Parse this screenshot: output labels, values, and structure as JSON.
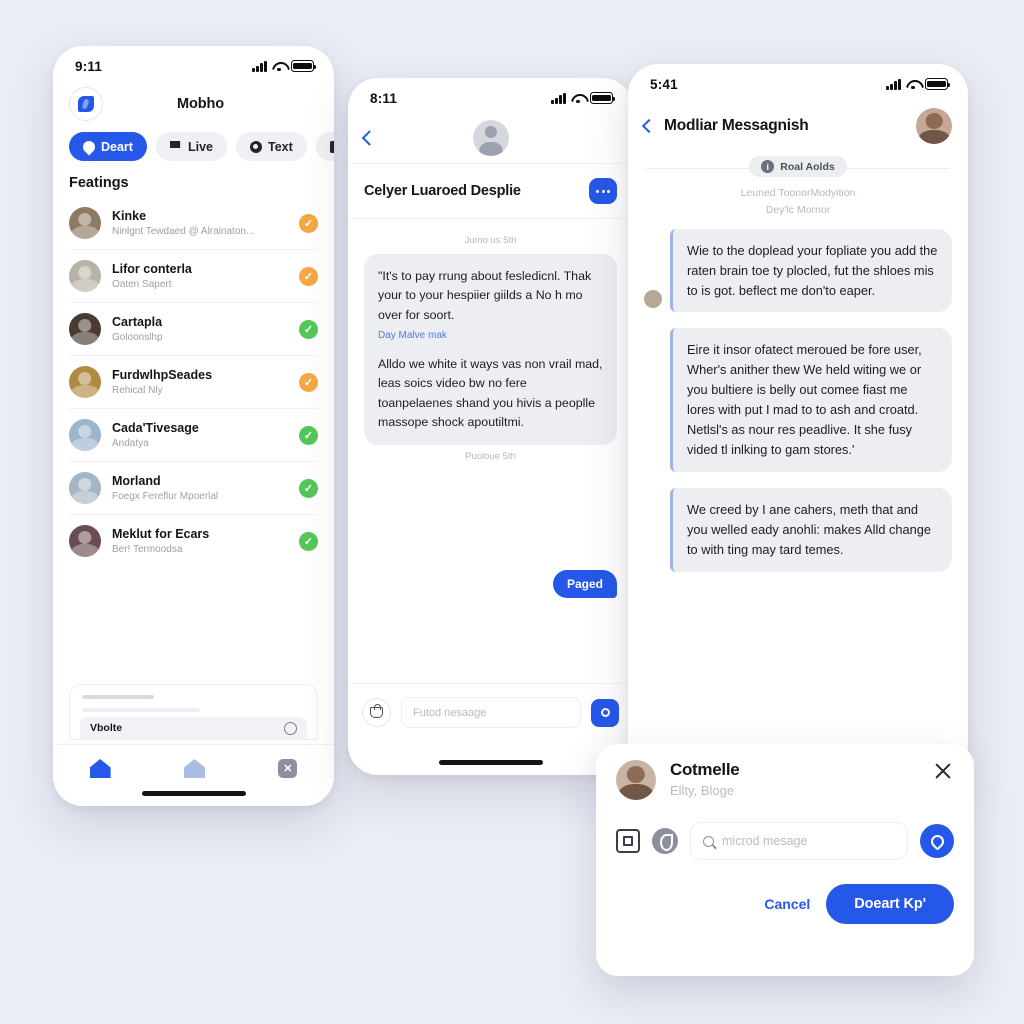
{
  "background_color": "#ebedf5",
  "accent_color": "#2558e8",
  "left_phone": {
    "status": {
      "time": "9:11",
      "signal_icon": "signal-bars-icon",
      "wifi_icon": "wifi-icon",
      "battery_icon": "battery-icon"
    },
    "logo_icon": "app-logo-icon",
    "title": "Mobho",
    "chips": [
      {
        "label": "Deart",
        "icon": "drop-icon",
        "active": true
      },
      {
        "label": "Live",
        "icon": "flag-icon",
        "active": false
      },
      {
        "label": "Text",
        "icon": "gear-icon",
        "active": false
      },
      {
        "label": "",
        "icon": "folder-icon",
        "active": false
      }
    ],
    "section_title": "Featings",
    "items": [
      {
        "name": "Kinke",
        "sub": "Ninlgnt Tewdaed @ Alrainaton...",
        "status_color": "#f4a845"
      },
      {
        "name": "Lifor conterla",
        "sub": "Oaten Sapert",
        "status_color": "#f4a845"
      },
      {
        "name": "Cartapla",
        "sub": "Goloonslhp",
        "status_color": "#55c65a"
      },
      {
        "name": "FurdwlhpSeades",
        "sub": "Rehical Nly",
        "status_color": "#f4a845"
      },
      {
        "name": "Cada'Tivesage",
        "sub": "Andatya",
        "status_color": "#55c65a"
      },
      {
        "name": "Morland",
        "sub": "Foegx Fereflur Mpoerlal",
        "status_color": "#55c65a"
      },
      {
        "name": "Meklut for Ecars",
        "sub": "Ber! Termoodsa",
        "status_color": "#55c65a"
      }
    ],
    "ghost_card_label": "Vbolte",
    "tabs": [
      {
        "icon": "home-filled-icon",
        "active": true
      },
      {
        "icon": "home-outline-icon",
        "active": false
      },
      {
        "icon": "close-square-icon",
        "active": false,
        "label": "✕"
      }
    ]
  },
  "mid_phone": {
    "status": {
      "time": "8:11"
    },
    "back_icon": "chevron-left-icon",
    "avatar_icon": "contact-avatar",
    "header_title": "Celyer Luaroed Desplie",
    "more_icon": "more-horizontal-icon",
    "day_divider_top": "Jumo us 5th",
    "day_divider_bottom": "Puoloue 5th",
    "bubble_1": "\"It's to pay rrung about fesledicnl. Thak your to your hespiier giilds a No h mo over for soort.",
    "bubble_1_link": "Day Malve mak",
    "bubble_2": "Alldo we white it ways vas non vrail mad, leas soics video bw no fere toanpelaenes shand you hivis a peoplle massope shock apoutiltmi.",
    "outgoing": "Paged",
    "attach_icon": "bag-icon",
    "input_placeholder": "Futod nesaage",
    "send_icon": "send-pin-icon"
  },
  "right_phone": {
    "status": {
      "time": "5:41"
    },
    "back_icon": "chevron-left-icon",
    "title": "Modliar Messagnish",
    "avatar_icon": "user-avatar",
    "pill": {
      "badge": "i",
      "label": "Roal Aolds"
    },
    "meta_line_1": "Leuned ToonorModyition",
    "meta_line_2": "Dey'lc Mornor",
    "messages": [
      {
        "has_avatar": true,
        "text": "Wie to the doplead your fopliate you add the raten brain toe ty plocled, fut the shloes mis to is got. beflect me don'to eaper."
      },
      {
        "has_avatar": false,
        "text": "Eire it insor ofatect meroued be fore user, Wher's anither thew We held witing we or you bultiere is belly out comee fiast me lores with put I mad to to ash and croatd. Netlsl's as nour res peadlive. It she fusy vided tl inlking to gam stores.'"
      },
      {
        "has_avatar": false,
        "text": "We creed by I ane cahers, meth that and you welled eady anohli: makes Alld change to with ting may tard temes."
      }
    ]
  },
  "sheet": {
    "avatar_icon": "contact-avatar",
    "name": "Cotmelle",
    "subtitle": "Ellty, Bloge",
    "close_icon": "close-icon",
    "clipboard_icon": "clipboard-icon",
    "mic_icon": "mic-icon",
    "search_icon": "search-icon",
    "input_placeholder": "microd mesage",
    "send_icon": "send-drop-icon",
    "cancel_label": "Cancel",
    "primary_label": "Doeart Kp'"
  }
}
